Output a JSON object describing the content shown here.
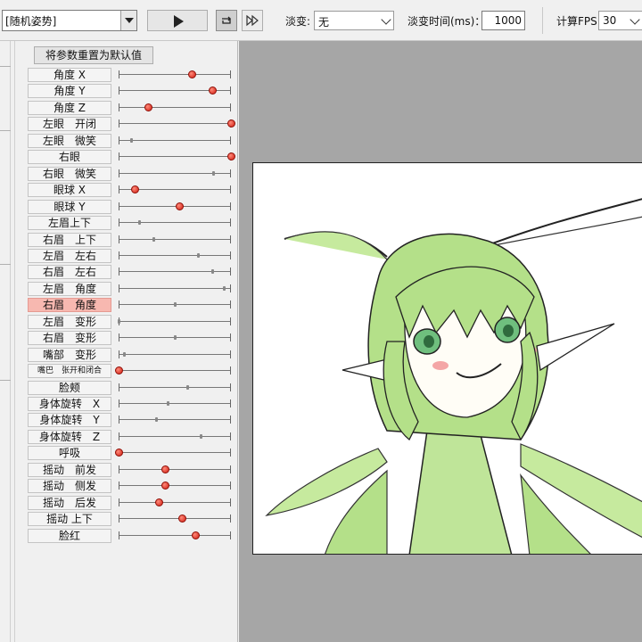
{
  "toolbar": {
    "pose_select": "[随机姿势]",
    "fade_label": "淡变:",
    "fade_value": "无",
    "fade_time_label": "淡变时间(ms)：",
    "fade_time_value": "1000",
    "fps_label": "计算FPS",
    "fps_value": "30"
  },
  "params_panel": {
    "reset_button": "将参数重置为默认值",
    "params": [
      {
        "label": "角度 X",
        "value": 0.65,
        "red": true
      },
      {
        "label": "角度 Y",
        "value": 0.83,
        "red": true
      },
      {
        "label": "角度 Z",
        "value": 0.26,
        "red": true
      },
      {
        "label": "左眼　开闭",
        "value": 1.0,
        "red": true
      },
      {
        "label": "左眼　微笑",
        "value": 0.11,
        "red": false
      },
      {
        "label": "右眼",
        "value": 1.0,
        "red": true
      },
      {
        "label": "右眼　微笑",
        "value": 0.84,
        "red": false
      },
      {
        "label": "眼球 X",
        "value": 0.14,
        "red": true
      },
      {
        "label": "眼球 Y",
        "value": 0.54,
        "red": true
      },
      {
        "label": "左眉上下",
        "value": 0.18,
        "red": false
      },
      {
        "label": "右眉　上下",
        "value": 0.31,
        "red": false
      },
      {
        "label": "左眉　左右",
        "value": 0.71,
        "red": false
      },
      {
        "label": "右眉　左右",
        "value": 0.83,
        "red": false
      },
      {
        "label": "左眉　角度",
        "value": 0.94,
        "red": false
      },
      {
        "label": "右眉　角度",
        "value": 0.5,
        "red": false,
        "selected": true
      },
      {
        "label": "左眉　变形",
        "value": 0.0,
        "red": false
      },
      {
        "label": "右眉　变形",
        "value": 0.5,
        "red": false
      },
      {
        "label": "嘴部　变形",
        "value": 0.05,
        "red": false
      },
      {
        "label": "嘴巴　张开和闭合",
        "value": 0.0,
        "red": true,
        "small": true
      },
      {
        "label": "脸颊",
        "value": 0.61,
        "red": false
      },
      {
        "label": "身体旋转　X",
        "value": 0.44,
        "red": false
      },
      {
        "label": "身体旋转　Y",
        "value": 0.33,
        "red": false
      },
      {
        "label": "身体旋转　Z",
        "value": 0.73,
        "red": false
      },
      {
        "label": "呼吸",
        "value": 0.0,
        "red": true
      },
      {
        "label": "摇动　前发",
        "value": 0.41,
        "red": true
      },
      {
        "label": "摇动　侧发",
        "value": 0.41,
        "red": true
      },
      {
        "label": "摇动　后发",
        "value": 0.36,
        "red": true
      },
      {
        "label": "摇动 上下",
        "value": 0.56,
        "red": true
      },
      {
        "label": "脸红",
        "value": 0.68,
        "red": true
      }
    ]
  },
  "colors": {
    "canvas_bg": "#a6a6a6",
    "hair_fill": "#b4e089",
    "hair_stroke": "#222222",
    "eye": "#6fbf7e",
    "blush": "#f4a6a6",
    "selected_label": "#f7b8b0",
    "active_knob": "#d01c10"
  },
  "icons": [
    "dropdown-arrow-icon",
    "play-icon",
    "loop-icon",
    "fast-forward-icon",
    "chevron-down-icon"
  ]
}
